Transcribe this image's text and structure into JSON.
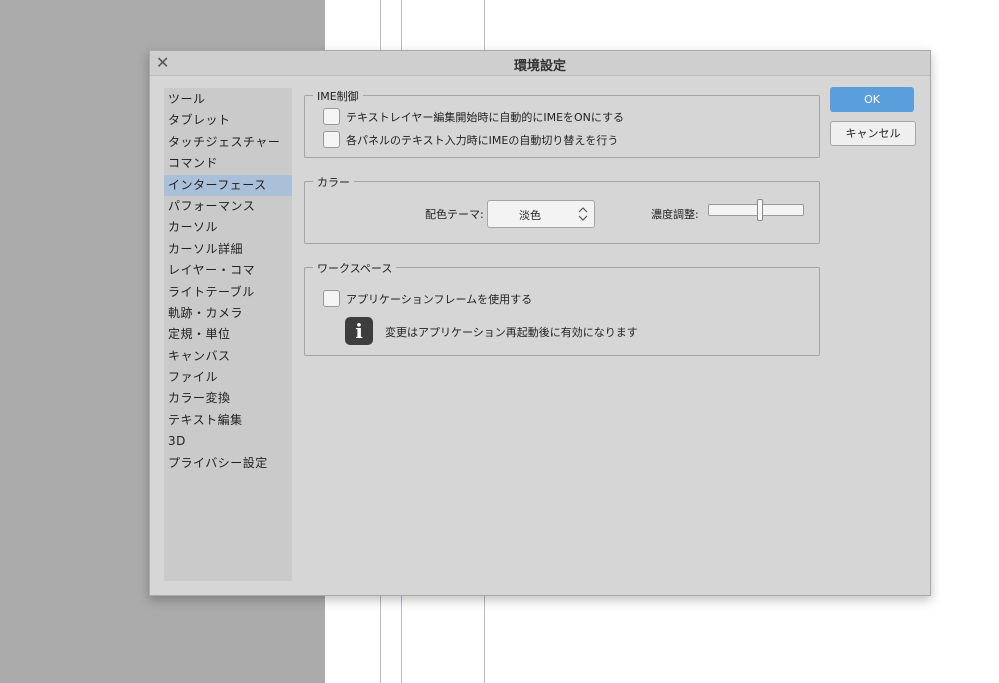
{
  "window": {
    "title": "環境設定",
    "close_icon": "close-icon"
  },
  "sidebar": {
    "selected": "インターフェース",
    "items": [
      {
        "label": "ツール"
      },
      {
        "label": "タブレット"
      },
      {
        "label": "タッチジェスチャー"
      },
      {
        "label": "コマンド"
      },
      {
        "label": "インターフェース"
      },
      {
        "label": "パフォーマンス"
      },
      {
        "label": "カーソル"
      },
      {
        "label": "カーソル詳細"
      },
      {
        "label": "レイヤー・コマ"
      },
      {
        "label": "ライトテーブル"
      },
      {
        "label": "軌跡・カメラ"
      },
      {
        "label": "定規・単位"
      },
      {
        "label": "キャンバス"
      },
      {
        "label": "ファイル"
      },
      {
        "label": "カラー変換"
      },
      {
        "label": "テキスト編集"
      },
      {
        "label": "3D"
      },
      {
        "label": "プライバシー設定"
      }
    ]
  },
  "ime_group": {
    "label": "IME制御",
    "option1": {
      "label": "テキストレイヤー編集開始時に自動的にIMEをONにする",
      "checked": false
    },
    "option2": {
      "label": "各パネルのテキスト入力時にIMEの自動切り替えを行う",
      "checked": false
    }
  },
  "color_group": {
    "label": "カラー",
    "theme_label": "配色テーマ:",
    "theme_value": "淡色",
    "density_label": "濃度調整:",
    "density_level": 0.55
  },
  "workspace_group": {
    "label": "ワークスペース",
    "app_frame": {
      "label": "アプリケーションフレームを使用する",
      "checked": false
    },
    "info_icon": "info-icon",
    "info_text": "変更はアプリケーション再起動後に有効になります"
  },
  "buttons": {
    "ok": "OK",
    "cancel": "キャンセル"
  },
  "colors": {
    "accent": "#5b9edc",
    "selection": "#a9c0d8"
  }
}
